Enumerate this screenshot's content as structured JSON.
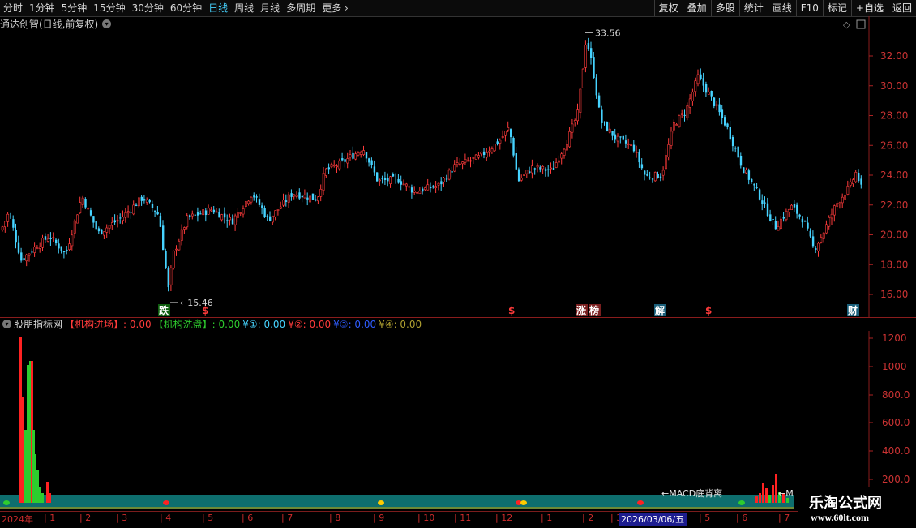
{
  "toolbar": {
    "periods": [
      "分时",
      "1分钟",
      "5分钟",
      "15分钟",
      "30分钟",
      "60分钟",
      "日线",
      "周线",
      "月线",
      "多周期",
      "更多"
    ],
    "active_period": "日线",
    "more_icon": "chevron-right",
    "buttons": [
      "复权",
      "叠加",
      "多股",
      "统计",
      "画线",
      "F10",
      "标记",
      "+自选",
      "返回"
    ]
  },
  "main_chart": {
    "title": "通达创智(日线,前复权)",
    "y_ticks": [
      "32.00",
      "30.00",
      "28.00",
      "26.00",
      "24.00",
      "22.00",
      "20.00",
      "18.00",
      "16.00"
    ],
    "high_label": "33.56",
    "low_label": "15.46",
    "markers": [
      {
        "text": "跌",
        "color": "#2ecc2e"
      },
      {
        "text": "$",
        "color": "#ff3b3b"
      },
      {
        "text": "$",
        "color": "#ff3b3b"
      },
      {
        "text": "涨",
        "color": "#ff5a5a"
      },
      {
        "text": "榜",
        "color": "#ff5a5a"
      },
      {
        "text": "解",
        "color": "#46d3ff"
      },
      {
        "text": "$",
        "color": "#ff3b3b"
      },
      {
        "text": "财",
        "color": "#46d3ff"
      }
    ],
    "up_color": "#ff3b3b",
    "down_color": "#46d3ff"
  },
  "indicator": {
    "name": "股朋指标网",
    "items": [
      {
        "label": "【机构进场】",
        "value": ": 0.00",
        "color": "#ff3b3b"
      },
      {
        "label": "【机构洗盘】",
        "value": ": 0.00",
        "color": "#2ecc2e"
      },
      {
        "label": "¥①",
        "value": ": 0.00",
        "color": "#46d3ff"
      },
      {
        "label": "¥②",
        "value": ": 0.00",
        "color": "#ff3b3b"
      },
      {
        "label": "¥③",
        "value": ": 0.00",
        "color": "#2f5cff"
      },
      {
        "label": "¥④",
        "value": ": 0.00",
        "color": "#b0a030"
      }
    ],
    "y_ticks": [
      "1200",
      "1000",
      "800.0",
      "600.0",
      "400.0",
      "200.0"
    ],
    "annotation": "←MACD底背离",
    "annotation2": "←M",
    "band_color": "#0e6e6e"
  },
  "date_axis": {
    "labels": [
      "2024年",
      "1",
      "2",
      "3",
      "4",
      "5",
      "6",
      "7",
      "8",
      "9",
      "10",
      "11",
      "12",
      "1",
      "2",
      "3",
      "5",
      "6",
      "7"
    ],
    "current_date": "2026/03/06/五"
  },
  "watermark": {
    "line1": "乐淘公式网",
    "line2": "www.60lt.com"
  }
}
